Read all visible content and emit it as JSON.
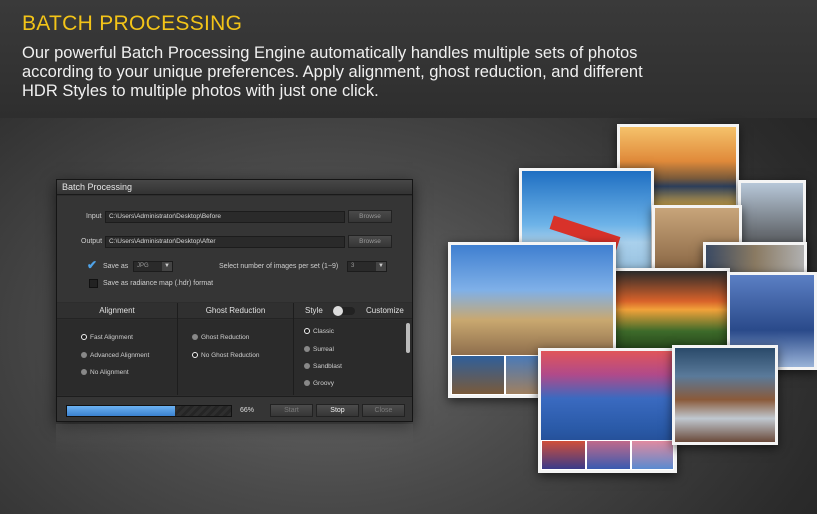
{
  "section": {
    "heading": "BATCH PROCESSING",
    "description": "Our powerful Batch Processing Engine automatically handles multiple sets of photos according to your unique preferences. Apply alignment, ghost reduction, and different HDR Styles to multiple photos with just one click.",
    "heading_color": "#f3c418"
  },
  "dialog": {
    "title": "Batch Processing",
    "input_label": "Input",
    "input_path": "C:\\Users\\Administrator\\Desktop\\Before",
    "output_label": "Output",
    "output_path": "C:\\Users\\Administrator\\Desktop\\After",
    "browse_label": "Browse",
    "save_as_label": "Save as",
    "save_as_checked": true,
    "save_format": "JPG",
    "images_per_set_label": "Select number of images per set (1~9)",
    "images_per_set_value": "3",
    "radiance_label": "Save as radiance map (.hdr) format",
    "radiance_checked": false,
    "alignment": {
      "header": "Alignment",
      "options": [
        "Fast Alignment",
        "Advanced Alignment",
        "No Alignment"
      ],
      "selected": "Fast Alignment"
    },
    "ghost": {
      "header": "Ghost Reduction",
      "options": [
        "Ghost Reduction",
        "No Ghost Reduction"
      ],
      "selected": "No Ghost Reduction"
    },
    "style": {
      "header": "Style",
      "customize_label": "Customize",
      "options": [
        "Classic",
        "Surreal",
        "Sandblast",
        "Groovy"
      ],
      "selected": "Classic"
    },
    "progress": 0.66,
    "progress_text": "66%",
    "buttons": {
      "start": "Start",
      "stop": "Stop",
      "close": "Close"
    },
    "progress_color": "#3b82d0"
  }
}
